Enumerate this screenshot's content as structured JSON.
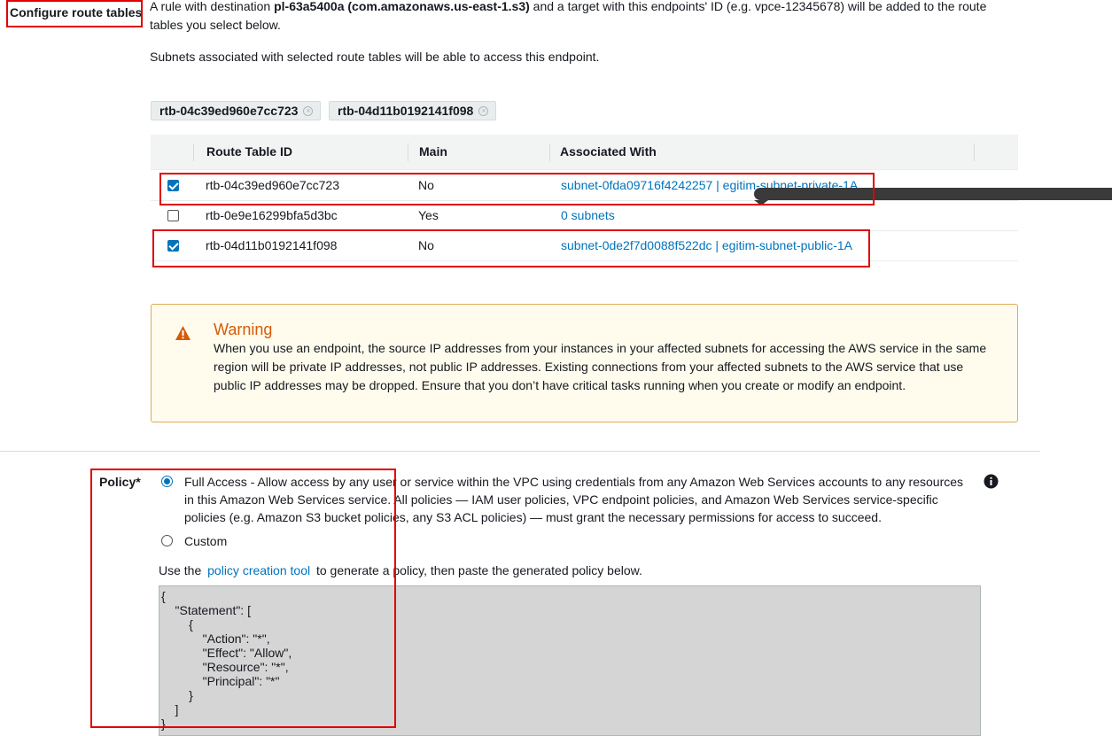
{
  "route_tables": {
    "section_label": "Configure route tables",
    "desc_prefix": "A rule with destination ",
    "desc_bold": "pl-63a5400a (com.amazonaws.us-east-1.s3)",
    "desc_suffix_line1": " and a target with this endpoints' ID (e.g. vpce-12345678) will be added to the route",
    "desc_line2": "tables you select below.",
    "subnet_note": "Subnets associated with selected route tables will be able to access this endpoint.",
    "chips": [
      "rtb-04c39ed960e7cc723",
      "rtb-04d11b0192141f098"
    ],
    "columns": {
      "id": "Route Table ID",
      "main": "Main",
      "assoc": "Associated With"
    },
    "rows": [
      {
        "id": "rtb-04c39ed960e7cc723",
        "main": "No",
        "assoc": "subnet-0fda09716f4242257 | egitim-subnet-private-1A",
        "checked": true
      },
      {
        "id": "rtb-0e9e16299bfa5d3bc",
        "main": "Yes",
        "assoc": "0 subnets",
        "checked": false
      },
      {
        "id": "rtb-04d11b0192141f098",
        "main": "No",
        "assoc": "subnet-0de2f7d0088f522dc | egitim-subnet-public-1A",
        "checked": true
      }
    ]
  },
  "warning": {
    "icon": "warning-triangle-icon",
    "title": "Warning",
    "text": "When you use an endpoint, the source IP addresses from your instances in your affected subnets for accessing the AWS service in the same region will be private IP addresses, not public IP addresses. Existing connections from your affected subnets to the AWS service that use public IP addresses may be dropped. Ensure that you don’t have critical tasks running when you create or modify an endpoint."
  },
  "policy": {
    "label": "Policy*",
    "full_access_text": "Full Access - Allow access by any user or service within the VPC using credentials from any Amazon Web Services accounts to any resources in this Amazon Web Services service. All policies — IAM user policies, VPC endpoint policies, and Amazon Web Services service-specific policies (e.g. Amazon S3 bucket policies, any S3 ACL policies) — must grant the necessary permissions for access to succeed.",
    "custom_label": "Custom",
    "selected": "full_access",
    "tool_prefix": "Use the",
    "tool_link": "policy creation tool",
    "tool_suffix": "to generate a policy, then paste the generated policy below.",
    "document": "{\n    \"Statement\": [\n        {\n            \"Action\": \"*\",\n            \"Effect\": \"Allow\",\n            \"Resource\": \"*\",\n            \"Principal\": \"*\"\n        }\n    ]\n}",
    "info_icon": "info-circle-icon"
  }
}
